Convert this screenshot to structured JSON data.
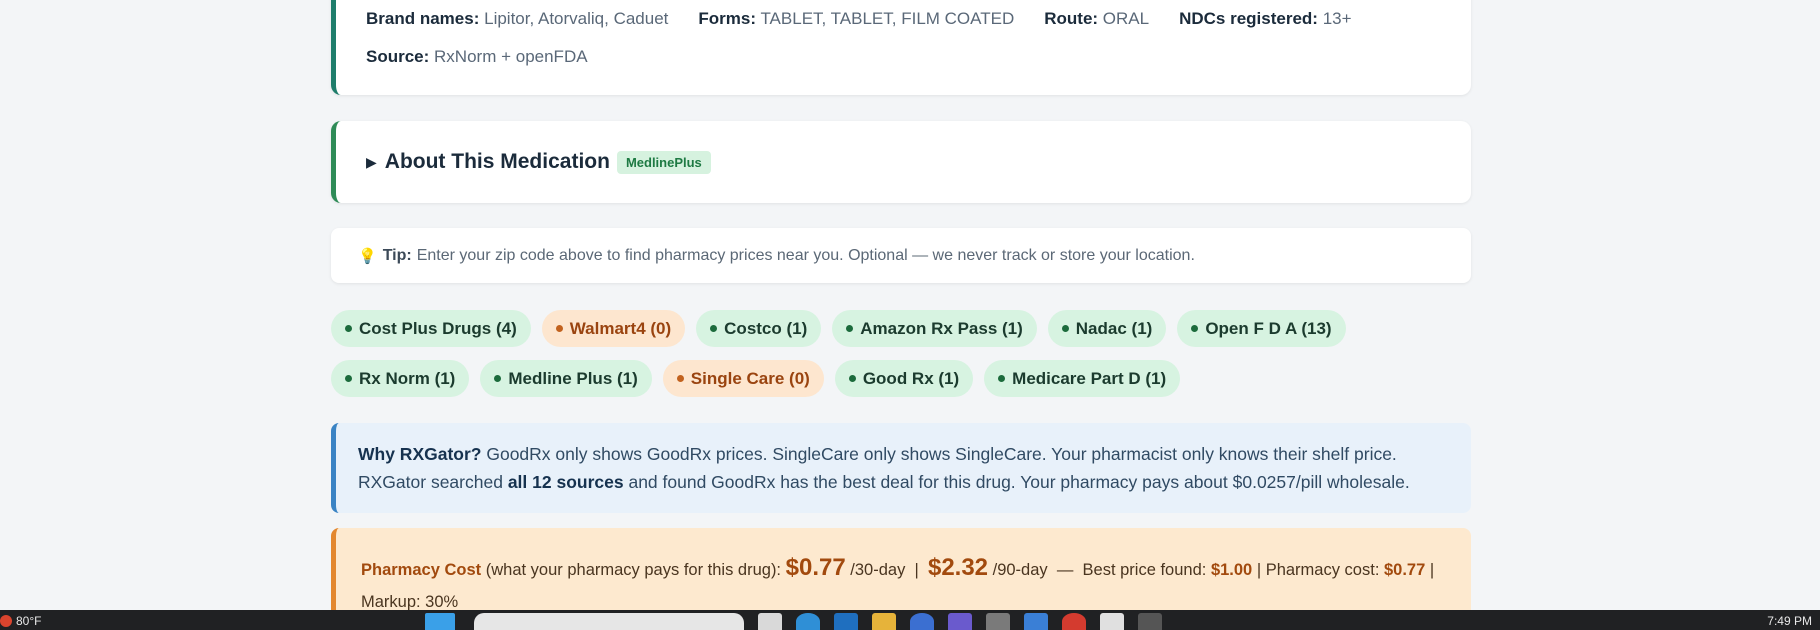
{
  "drug_info": {
    "brand_label": "Brand names:",
    "brand_value": "Lipitor, Atorvaliq, Caduet",
    "forms_label": "Forms:",
    "forms_value": "TABLET, TABLET, FILM COATED",
    "route_label": "Route:",
    "route_value": "ORAL",
    "ndc_label": "NDCs registered:",
    "ndc_value": "13+",
    "source_label": "Source:",
    "source_value": "RxNorm + openFDA"
  },
  "about": {
    "toggle_icon": "▶",
    "title": "About This Medication",
    "badge": "MedlinePlus"
  },
  "tip": {
    "icon": "💡",
    "label": "Tip:",
    "text": "Enter your zip code above to find pharmacy prices near you. Optional — we never track or store your location."
  },
  "sources": [
    {
      "label": "Cost Plus Drugs (4)",
      "status": "ok"
    },
    {
      "label": "Walmart4 (0)",
      "status": "zero"
    },
    {
      "label": "Costco (1)",
      "status": "ok"
    },
    {
      "label": "Amazon Rx Pass (1)",
      "status": "ok"
    },
    {
      "label": "Nadac (1)",
      "status": "ok"
    },
    {
      "label": "Open F D A (13)",
      "status": "ok"
    },
    {
      "label": "Rx Norm (1)",
      "status": "ok"
    },
    {
      "label": "Medline Plus (1)",
      "status": "ok"
    },
    {
      "label": "Single Care (0)",
      "status": "zero"
    },
    {
      "label": "Good Rx (1)",
      "status": "ok"
    },
    {
      "label": "Medicare Part D (1)",
      "status": "ok"
    }
  ],
  "why": {
    "lead": "Why RXGator?",
    "text1": "GoodRx only shows GoodRx prices. SingleCare only shows SingleCare. Your pharmacist only knows their shelf price. RXGator searched",
    "bold": "all 12 sources",
    "text2": "and found GoodRx has the best deal for this drug. Your pharmacy pays about $0.0257/pill wholesale."
  },
  "cost": {
    "label": "Pharmacy Cost",
    "desc": "(what your pharmacy pays for this drug):",
    "price30": "$0.77",
    "per30": "/30-day",
    "sep": "|",
    "price90": "$2.32",
    "per90": "/90-day",
    "dash": "—",
    "best_label": "Best price found:",
    "best_value": "$1.00",
    "pharm_label": "| Pharmacy cost:",
    "pharm_value": "$0.77",
    "markup": "| Markup: 30%"
  },
  "taskbar": {
    "temp": "80°F",
    "time": "7:49 PM"
  },
  "colors": {
    "ok_chip": "#d7f3e1",
    "zero_chip": "#fde6cf",
    "accent_teal": "#1e7d6b",
    "accent_blue": "#3a83c4",
    "accent_orange": "#e3872e"
  }
}
